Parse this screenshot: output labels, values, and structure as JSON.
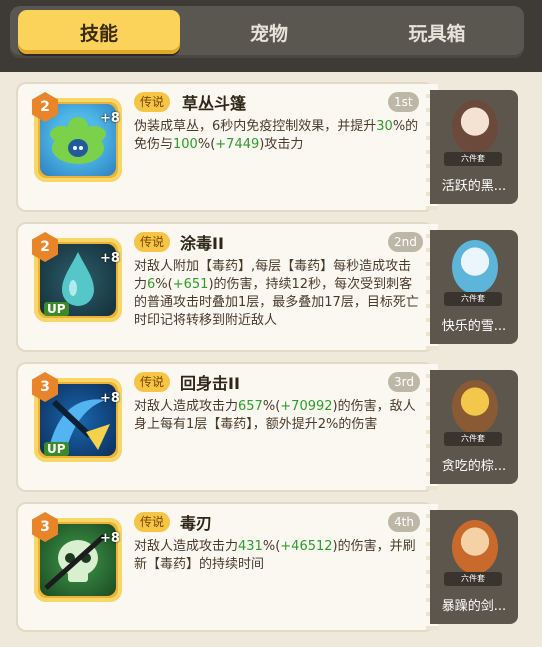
{
  "tabs": [
    {
      "label": "技能"
    },
    {
      "label": "宠物"
    },
    {
      "label": "玩具箱"
    }
  ],
  "badge": "传说",
  "cards": [
    {
      "level": "2",
      "plus": "+8",
      "name": "草丛斗篷",
      "rank": "1st",
      "desc": {
        "a": "伪装成草丛，6秒内免疫控制效果，并提升",
        "b": "30",
        "c": "%的免伤与",
        "d": "100",
        "e": "%(",
        "f": "+7449",
        "g": ")攻击力"
      },
      "pet": {
        "name": "活跃的黑...",
        "plinth": "六件套"
      }
    },
    {
      "level": "2",
      "plus": "+8",
      "name": "涂毒II",
      "rank": "2nd",
      "up": "UP",
      "desc": {
        "a": "对敌人附加【毒药】,每层【毒药】每秒造成攻击力",
        "b": "6",
        "c": "%(",
        "d": "+651",
        "e": ")的伤害，持续12秒，每次受到刺客的普通攻击时叠加1层，最多叠加17层，目标死亡时印记将转移到附近敌人"
      },
      "pet": {
        "name": "快乐的雪...",
        "plinth": "六件套"
      }
    },
    {
      "level": "3",
      "plus": "+8",
      "name": "回身击II",
      "rank": "3rd",
      "up": "UP",
      "desc": {
        "a": "对敌人造成攻击力",
        "b": "657",
        "c": "%(",
        "d": "+70992",
        "e": ")的伤害，敌人身上每有1层【毒药】，额外提升2%的伤害"
      },
      "pet": {
        "name": "贪吃的棕...",
        "plinth": "六件套"
      }
    },
    {
      "level": "3",
      "plus": "+8",
      "name": "毒刃",
      "rank": "4th",
      "desc": {
        "a": "对敌人造成攻击力",
        "b": "431",
        "c": "%(",
        "d": "+46512",
        "e": ")的伤害，并刷新【毒药】的持续时间"
      },
      "pet": {
        "name": "暴躁的剑...",
        "plinth": "六件套"
      }
    }
  ]
}
